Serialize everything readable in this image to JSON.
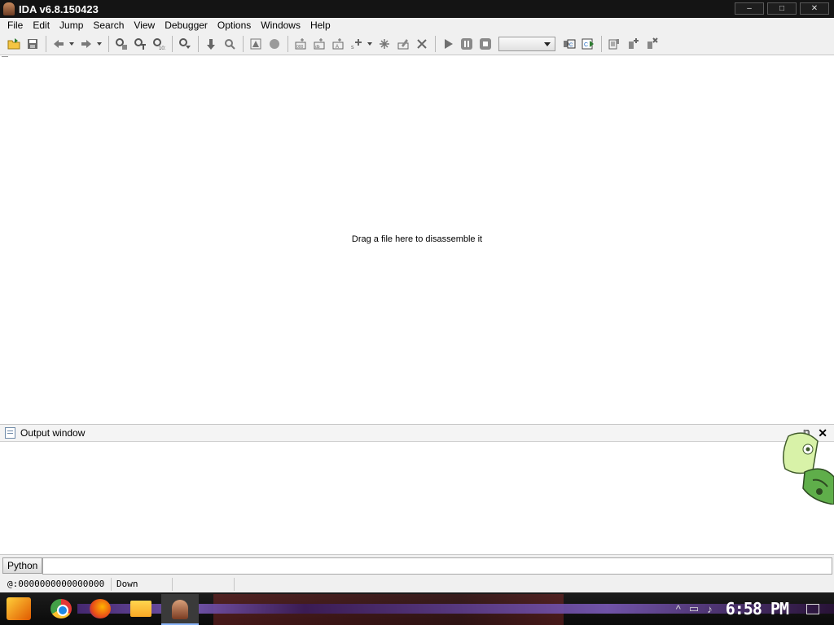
{
  "window": {
    "title": "IDA v6.8.150423",
    "minimize": "–",
    "maximize": "□",
    "close": "✕"
  },
  "menubar": {
    "items": [
      "File",
      "Edit",
      "Jump",
      "Search",
      "View",
      "Debugger",
      "Options",
      "Windows",
      "Help"
    ]
  },
  "toolbar": {
    "debugger_select_value": ""
  },
  "main": {
    "hint": "Drag a file here to disassemble it"
  },
  "output_window": {
    "title": "Output window",
    "restore": "⧉",
    "close": "✕"
  },
  "cli": {
    "button_label": "Python",
    "input_value": ""
  },
  "statusbar": {
    "address": "@:0000000000000000",
    "direction": "Down",
    "extra": ""
  },
  "taskbar": {
    "clock": "6:58 PM",
    "up_arrow": "^"
  }
}
